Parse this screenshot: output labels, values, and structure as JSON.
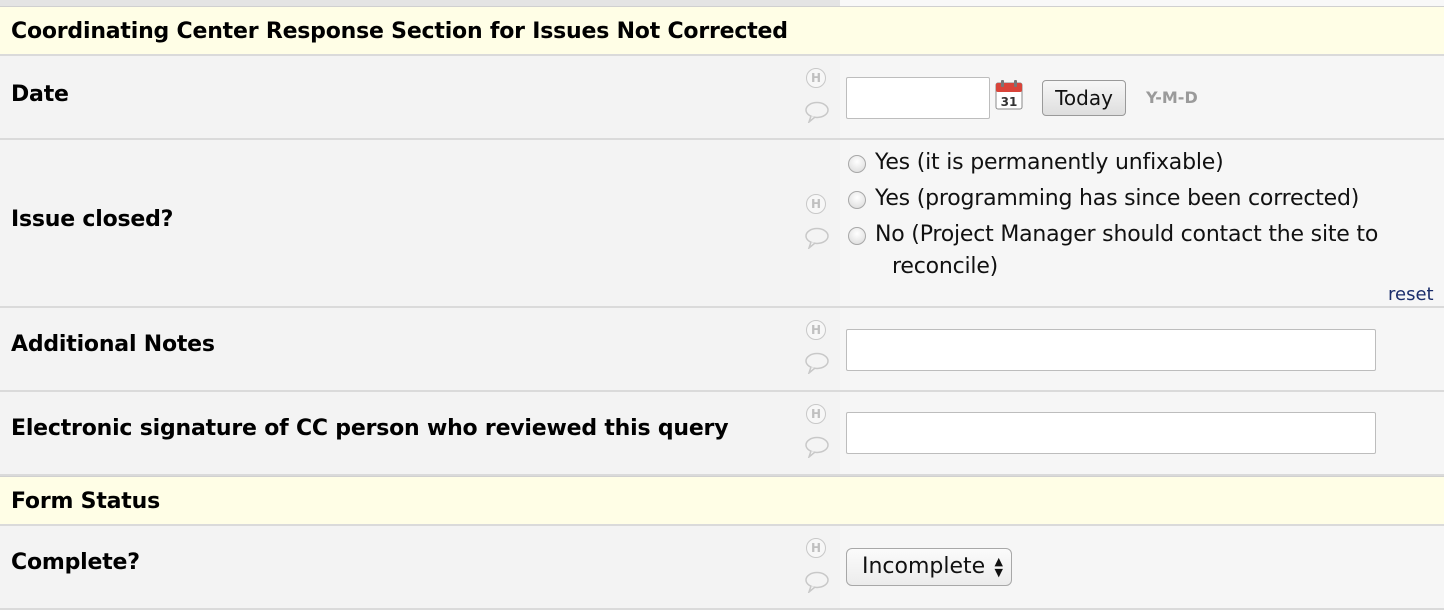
{
  "sections": {
    "coordinating_header": "Coordinating Center Response Section for Issues Not Corrected",
    "form_status_header": "Form Status"
  },
  "fields": {
    "date": {
      "label": "Date",
      "value": "",
      "today_label": "Today",
      "format_hint": "Y-M-D",
      "calendar_day": "31"
    },
    "issue_closed": {
      "label": "Issue closed?",
      "options": [
        "Yes (it is permanently unfixable)",
        "Yes (programming has since been corrected)",
        "No (Project Manager should contact the site to",
        "reconcile)"
      ],
      "reset_label": "reset"
    },
    "additional_notes": {
      "label": "Additional Notes",
      "value": ""
    },
    "signature": {
      "label": "Electronic signature of CC person who reviewed this query",
      "value": ""
    },
    "complete": {
      "label": "Complete?",
      "selected": "Incomplete"
    }
  },
  "icons": {
    "history_glyph": "H",
    "history_icon": "history-icon",
    "comment_icon": "comment-icon"
  }
}
